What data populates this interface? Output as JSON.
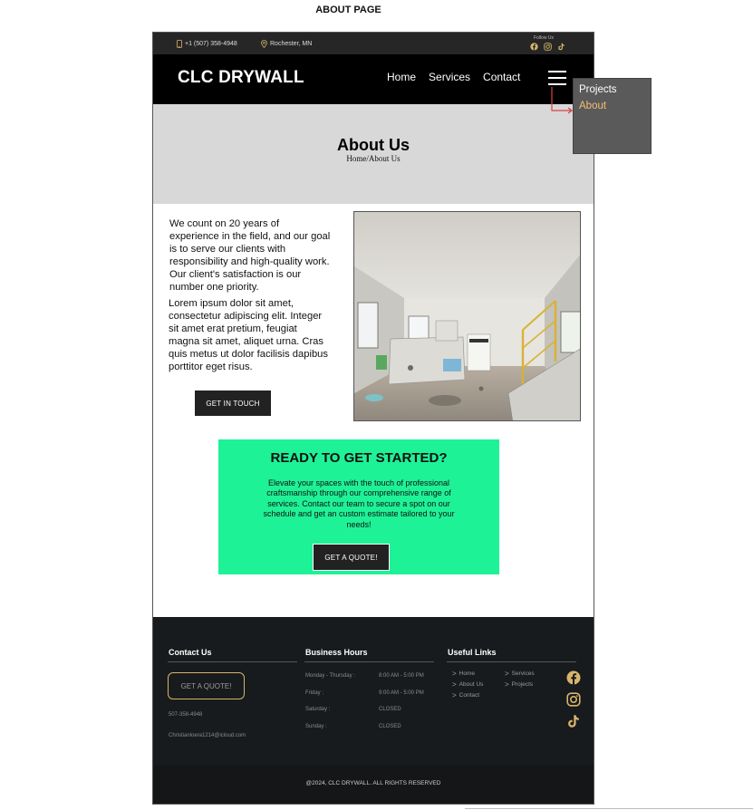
{
  "canvas_label": "ABOUT PAGE",
  "topbar": {
    "phone": "+1 (507) 358-4948",
    "location": "Rochester, MN",
    "follow_us": "Follow Us"
  },
  "nav": {
    "brand": "CLC DRYWALL",
    "links": [
      "Home",
      "Services",
      "Contact"
    ]
  },
  "dropdown": {
    "items": [
      "Projects",
      "About"
    ]
  },
  "hero": {
    "title": "About Us",
    "breadcrumb": "Home/About Us"
  },
  "about": {
    "paragraph1": "We count on 20 years of experience in the field, and our goal is to serve our clients with responsibility and high-quality work. Our client's satisfaction is our number one priority.",
    "paragraph2": "Lorem ipsum dolor sit amet, consectetur adipiscing elit. Integer sit amet erat pretium, feugiat magna sit amet, aliquet urna. Cras quis metus ut dolor facilisis dapibus porttitor eget risus.",
    "button": "GET IN TOUCH"
  },
  "cta": {
    "title": "READY TO GET STARTED?",
    "text": "Elevate your spaces with the touch of professional craftsmanship through our comprehensive range of services. Contact our team to secure a spot on our schedule and get an custom estimate tailored to your needs!",
    "button": "GET A QUOTE!"
  },
  "footer": {
    "contact": {
      "title": "Contact Us",
      "button": "GET A QUOTE!",
      "phone": "507-358-4948",
      "email": "Christianloera1214@icloud.com"
    },
    "hours": {
      "title": "Business Hours",
      "rows": [
        {
          "day": "Monday - Thursday :",
          "time": "8:00 AM - 5:00 PM"
        },
        {
          "day": "Friday :",
          "time": "9:00 AM - 5:00 PM"
        },
        {
          "day": "Saturday :",
          "time": "CLOSED"
        },
        {
          "day": "Sunday :",
          "time": "CLOSED"
        }
      ]
    },
    "links": {
      "title": "Useful Links",
      "col1": [
        "Home",
        "About Us",
        "Contact"
      ],
      "col2": [
        "Services",
        "Projects"
      ]
    },
    "copyright": "@2024, CLC DRYWALL. ALL RIGHTS RESERVED"
  },
  "colors": {
    "cta_green": "#1ef296",
    "footer_bg": "#181b1d",
    "accent_gold": "#d4b46a",
    "arrow_red": "#e04040"
  }
}
